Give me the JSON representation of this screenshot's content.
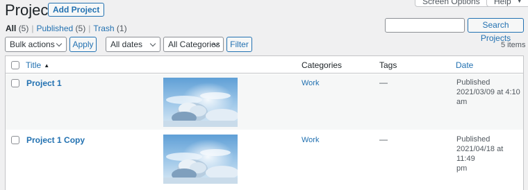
{
  "header": {
    "title": "Projects",
    "add_new_label": "Add Project",
    "screen_options_label": "Screen Options",
    "help_label": "Help"
  },
  "views": {
    "all_label": "All",
    "all_count": "(5)",
    "published_label": "Published",
    "published_count": "(5)",
    "trash_label": "Trash",
    "trash_count": "(1)",
    "separator": "|"
  },
  "search": {
    "value": "",
    "button_label": "Search Projects"
  },
  "filters": {
    "bulk_actions": "Bulk actions",
    "apply_label": "Apply",
    "dates": "All dates",
    "categories": "All Categories",
    "filter_label": "Filter",
    "items_count": "5 items"
  },
  "table": {
    "columns": {
      "title": "Title",
      "categories": "Categories",
      "tags": "Tags",
      "date": "Date"
    },
    "rows": [
      {
        "title": "Project 1",
        "category": "Work",
        "tags": "—",
        "status": "Published",
        "date_line1": "2021/03/09 at 4:10",
        "date_line2": "am"
      },
      {
        "title": "Project 1 Copy",
        "category": "Work",
        "tags": "—",
        "status": "Published",
        "date_line1": "2021/04/18 at 11:49",
        "date_line2": "pm"
      }
    ]
  },
  "colors": {
    "accent": "#2271b1",
    "background": "#f0f0f1",
    "text": "#1d2327"
  }
}
